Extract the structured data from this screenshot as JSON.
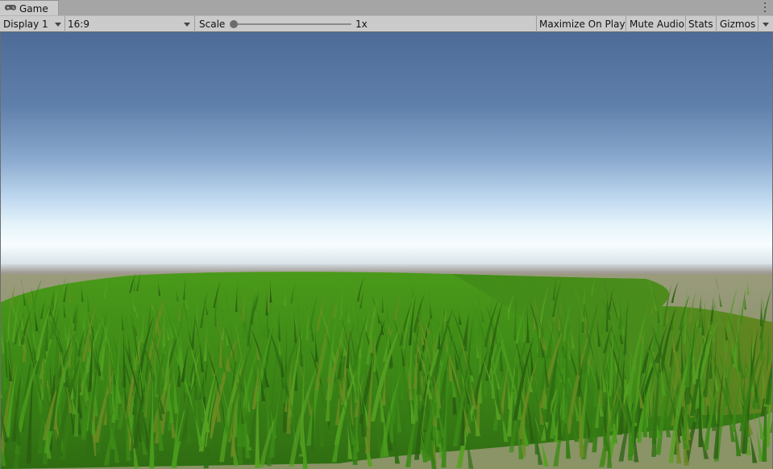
{
  "tab": {
    "title": "Game",
    "icon": "gamepad-icon"
  },
  "toolbar": {
    "display": "Display 1",
    "aspect": "16:9",
    "scale_label": "Scale",
    "scale_value": "1x",
    "scale_fraction": 0.0,
    "maximize": "Maximize On Play",
    "mute": "Mute Audio",
    "stats": "Stats",
    "gizmos": "Gizmos"
  },
  "scene": {
    "description_icon": "grass-field-scene",
    "colors": {
      "sky_top": "#4e6b97",
      "sky_horizon": "#f7fdff",
      "grass": "#3e8a18",
      "ground": "#8f9670"
    }
  }
}
